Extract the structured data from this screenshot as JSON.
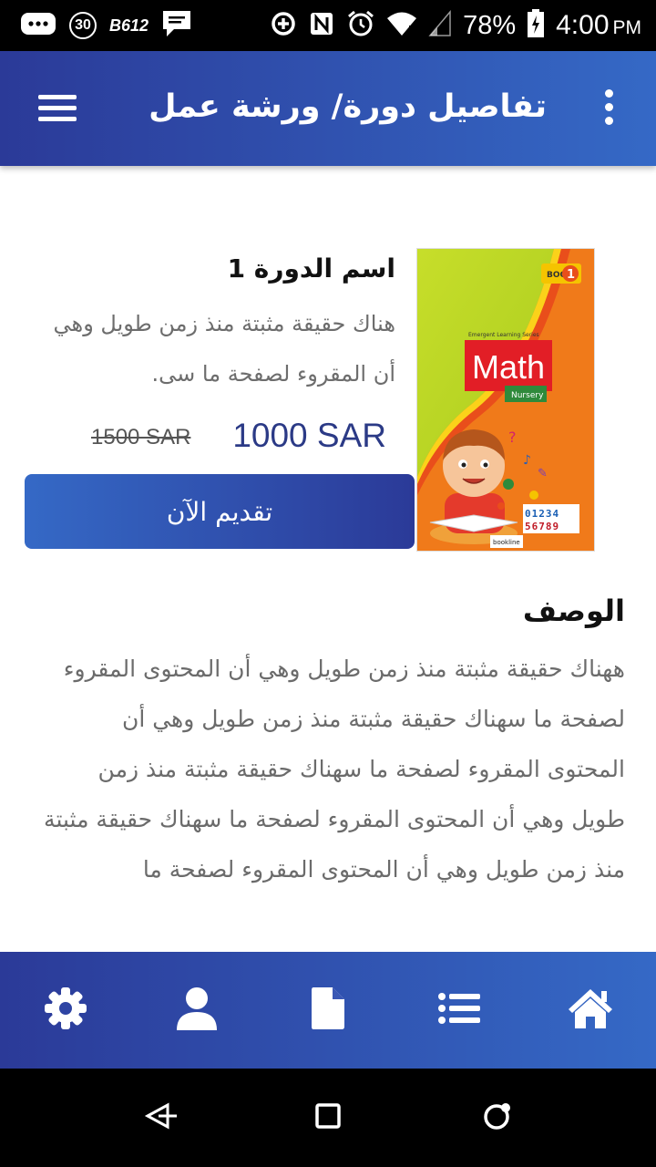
{
  "status_bar": {
    "badge_30": "30",
    "badge_b612": "B612",
    "battery_percent": "78%",
    "time": "4:00",
    "am_pm": "PM"
  },
  "app_bar": {
    "title": "تفاصيل دورة/ ورشة عمل"
  },
  "course": {
    "name": "اسم الدورة 1",
    "short_description": "هناك حقيقة مثبتة منذ زمن طويل وهي أن المقروء لصفحة ما سى.",
    "price": "1000 SAR",
    "old_price": "1500 SAR",
    "apply_label": "تقديم الآن",
    "cover": {
      "series": "Emergent Learning Series",
      "subject": "Math",
      "level": "Nursery",
      "book": "BOOK",
      "book_number": "1",
      "digits_row1": "01234",
      "digits_row2": "56789",
      "publisher": "bookline"
    }
  },
  "description": {
    "title": "الوصف",
    "body": "ههناك حقيقة مثبتة منذ زمن طويل وهي أن المحتوى المقروء لصفحة ما سهناك حقيقة مثبتة منذ زمن طويل وهي أن المحتوى المقروء لصفحة ما سهناك حقيقة مثبتة منذ زمن طويل وهي أن المحتوى المقروء لصفحة ما سهناك حقيقة مثبتة منذ زمن طويل وهي أن المحتوى المقروء لصفحة ما"
  },
  "bottom_nav": {
    "items": [
      "gear-icon",
      "user-icon",
      "document-icon",
      "list-icon",
      "home-icon"
    ]
  },
  "colors": {
    "bar_dark": "#2b3a98",
    "bar_light": "#3569c6",
    "price": "#2b3a86",
    "text_muted": "#6d6d6d"
  }
}
